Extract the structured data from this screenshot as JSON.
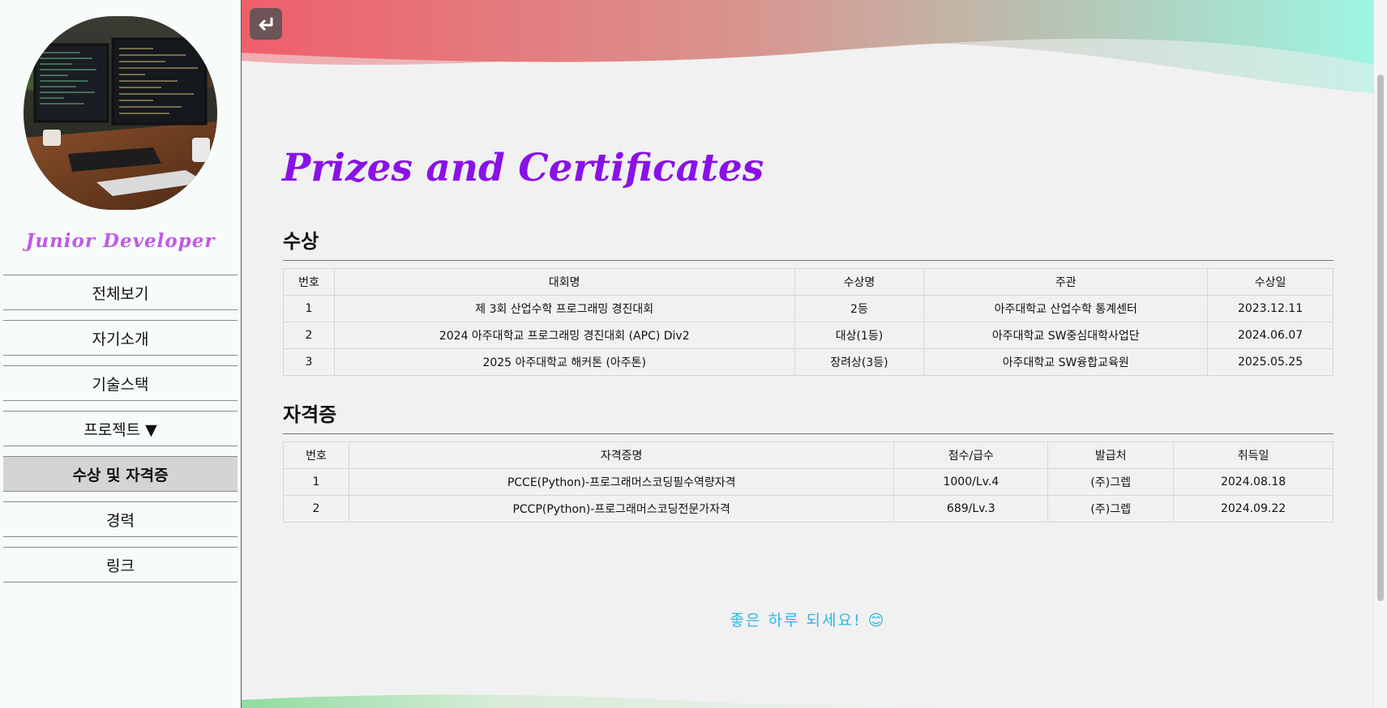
{
  "sidebar": {
    "brand": "Junior Developer",
    "avatar_alt": "workstation-photo",
    "items": [
      {
        "label": "전체보기"
      },
      {
        "label": "자기소개"
      },
      {
        "label": "기술스택"
      },
      {
        "label": "프로젝트 ▼"
      },
      {
        "label": "수상 및 자격증",
        "active": true
      },
      {
        "label": "경력"
      },
      {
        "label": "링크"
      }
    ]
  },
  "main": {
    "title": "Prizes and Certificates",
    "awards": {
      "heading": "수상",
      "columns": [
        "번호",
        "대회명",
        "수상명",
        "주관",
        "수상일"
      ],
      "rows": [
        [
          "1",
          "제 3회 산업수학 프로그래밍 경진대회",
          "2등",
          "아주대학교 산업수학 통계센터",
          "2023.12.11"
        ],
        [
          "2",
          "2024 아주대학교 프로그래밍 경진대회 (APC) Div2",
          "대상(1등)",
          "아주대학교 SW중심대학사업단",
          "2024.06.07"
        ],
        [
          "3",
          "2025 아주대학교 해커톤 (아주톤)",
          "장려상(3등)",
          "아주대학교 SW융합교육원",
          "2025.05.25"
        ]
      ]
    },
    "certs": {
      "heading": "자격증",
      "columns": [
        "번호",
        "자격증명",
        "점수/급수",
        "발급처",
        "취득일"
      ],
      "rows": [
        [
          "1",
          "PCCE(Python)-프로그래머스코딩필수역량자격",
          "1000/Lv.4",
          "(주)그렙",
          "2024.08.18"
        ],
        [
          "2",
          "PCCP(Python)-프로그래머스코딩전문가자격",
          "689/Lv.3",
          "(주)그렙",
          "2024.09.22"
        ]
      ]
    },
    "footer": "좋은 하루 되세요! 😊"
  },
  "colors": {
    "title": "#8a11e6",
    "brand": "#c05ae6",
    "footer": "#2fb6e5",
    "wave_left": "#ef5f6a",
    "wave_right": "#9ef5e3"
  },
  "icons": {
    "back": "return-arrow-icon"
  }
}
